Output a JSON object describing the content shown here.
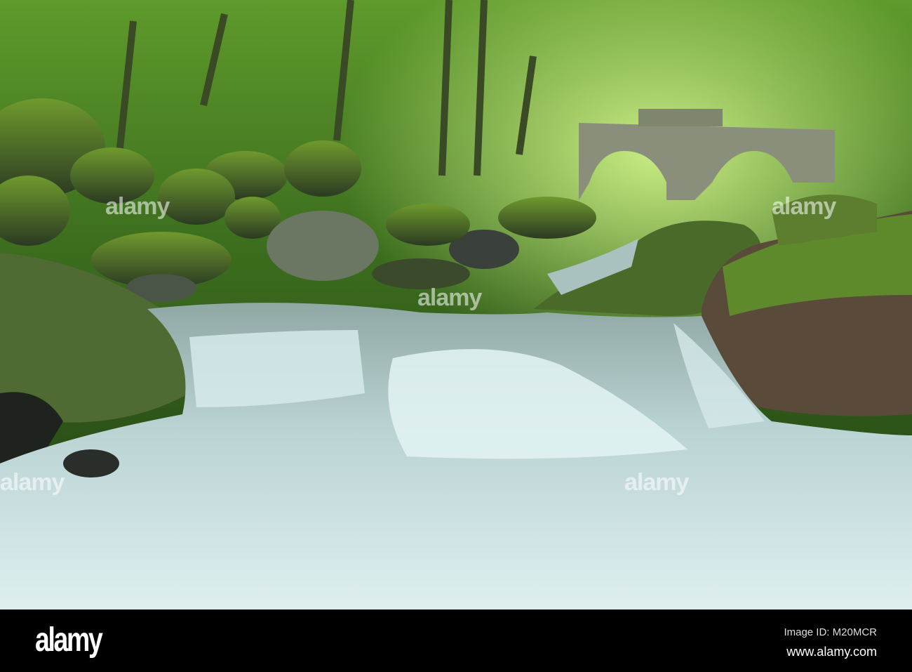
{
  "watermark": {
    "text": "alamy"
  },
  "footer": {
    "logo": "alamy",
    "image_id": "Image ID: M20MCR",
    "website": "www.alamy.com"
  }
}
